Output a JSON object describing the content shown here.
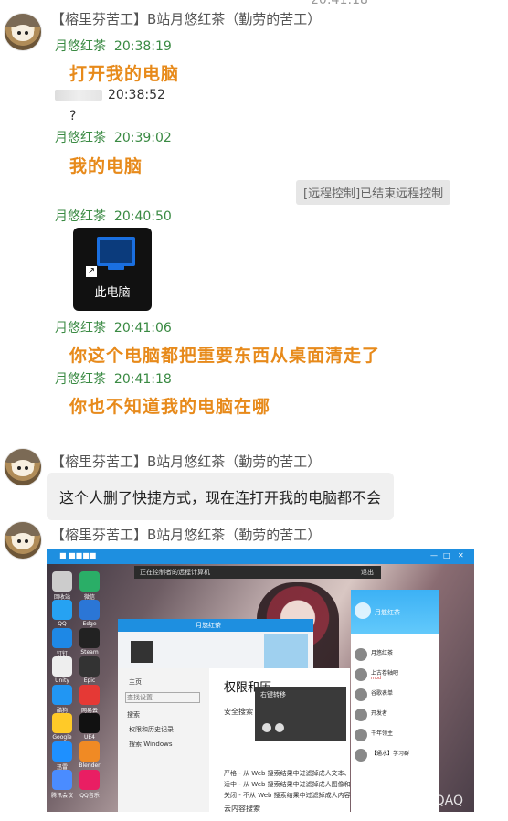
{
  "top_timestamp": "20:41:18",
  "messages": [
    {
      "sender": "【榕里芬苦工】B站月悠红茶（勤劳的苦工）"
    },
    {
      "sender": "【榕里芬苦工】B站月悠红茶（勤劳的苦工）",
      "text": "这个人删了快捷方式，现在连打开我的电脑都不会"
    },
    {
      "sender": "【榕里芬苦工】B站月悠红茶（勤劳的苦工）"
    }
  ],
  "forwarded": {
    "r1_name": "月悠红茶",
    "r1_time": "20:38:19",
    "r1_text": "打开我的电脑",
    "r2_time": "20:38:52",
    "r2_text": "?",
    "r3_name": "月悠红茶",
    "r3_time": "20:39:02",
    "r3_text": "我的电脑",
    "system_tip": "[远程控制]已结束远程控制",
    "r4_name": "月悠红茶",
    "r4_time": "20:40:50",
    "r4_card_label": "此电脑",
    "r5_name": "月悠红茶",
    "r5_time": "20:41:06",
    "r5_text": "你这个电脑都把重要东西从桌面清走了",
    "r6_name": "月悠红茶",
    "r6_time": "20:41:18",
    "r6_text": "你也不知道我的电脑在哪"
  },
  "screenshot": {
    "ctrl_text": "正在控制者的远程计算机",
    "ctrl_exit": "退出",
    "win_title": "月悠红茶",
    "settings_title": "权限和历",
    "settings_home": "主页",
    "settings_search": "搜索",
    "settings_find": "查找设置",
    "settings_item1": "权限和历史记录",
    "settings_item2": "搜索 Windows",
    "safe_search": "安全搜索",
    "opt1": "严格 - 从 Web 搜索结果中过滤掉成人文本、图像和视频",
    "opt2": "适中 - 从 Web 搜索结果中过滤掉成人图像和视频，文本除外",
    "opt3": "关闭 - 不从 Web 搜索结果中过滤掉成人内容",
    "cloud_search": "云内容搜索",
    "popup_title": "右键转移",
    "qq_name": "月悠红茶",
    "qq_rows": [
      {
        "name": "月悠红茶",
        "msg": ""
      },
      {
        "name": "上古卷轴吧",
        "msg": "mod"
      },
      {
        "name": "谷歌表单",
        "msg": ""
      },
      {
        "name": "开发者",
        "msg": ""
      },
      {
        "name": "千年领主",
        "msg": ""
      },
      {
        "name": "【通水】学习群",
        "msg": ""
      }
    ],
    "desktop_icons": [
      "回收站",
      "微信",
      "QQ",
      "Edge",
      "钉钉",
      "Steam",
      "Unity",
      "Epic",
      "酷狗",
      "网易云",
      "Google",
      "UE4",
      "迅雷",
      "Blender",
      "腾讯会议",
      "QQ音乐"
    ]
  },
  "watermark": "知乎 @QAQ"
}
